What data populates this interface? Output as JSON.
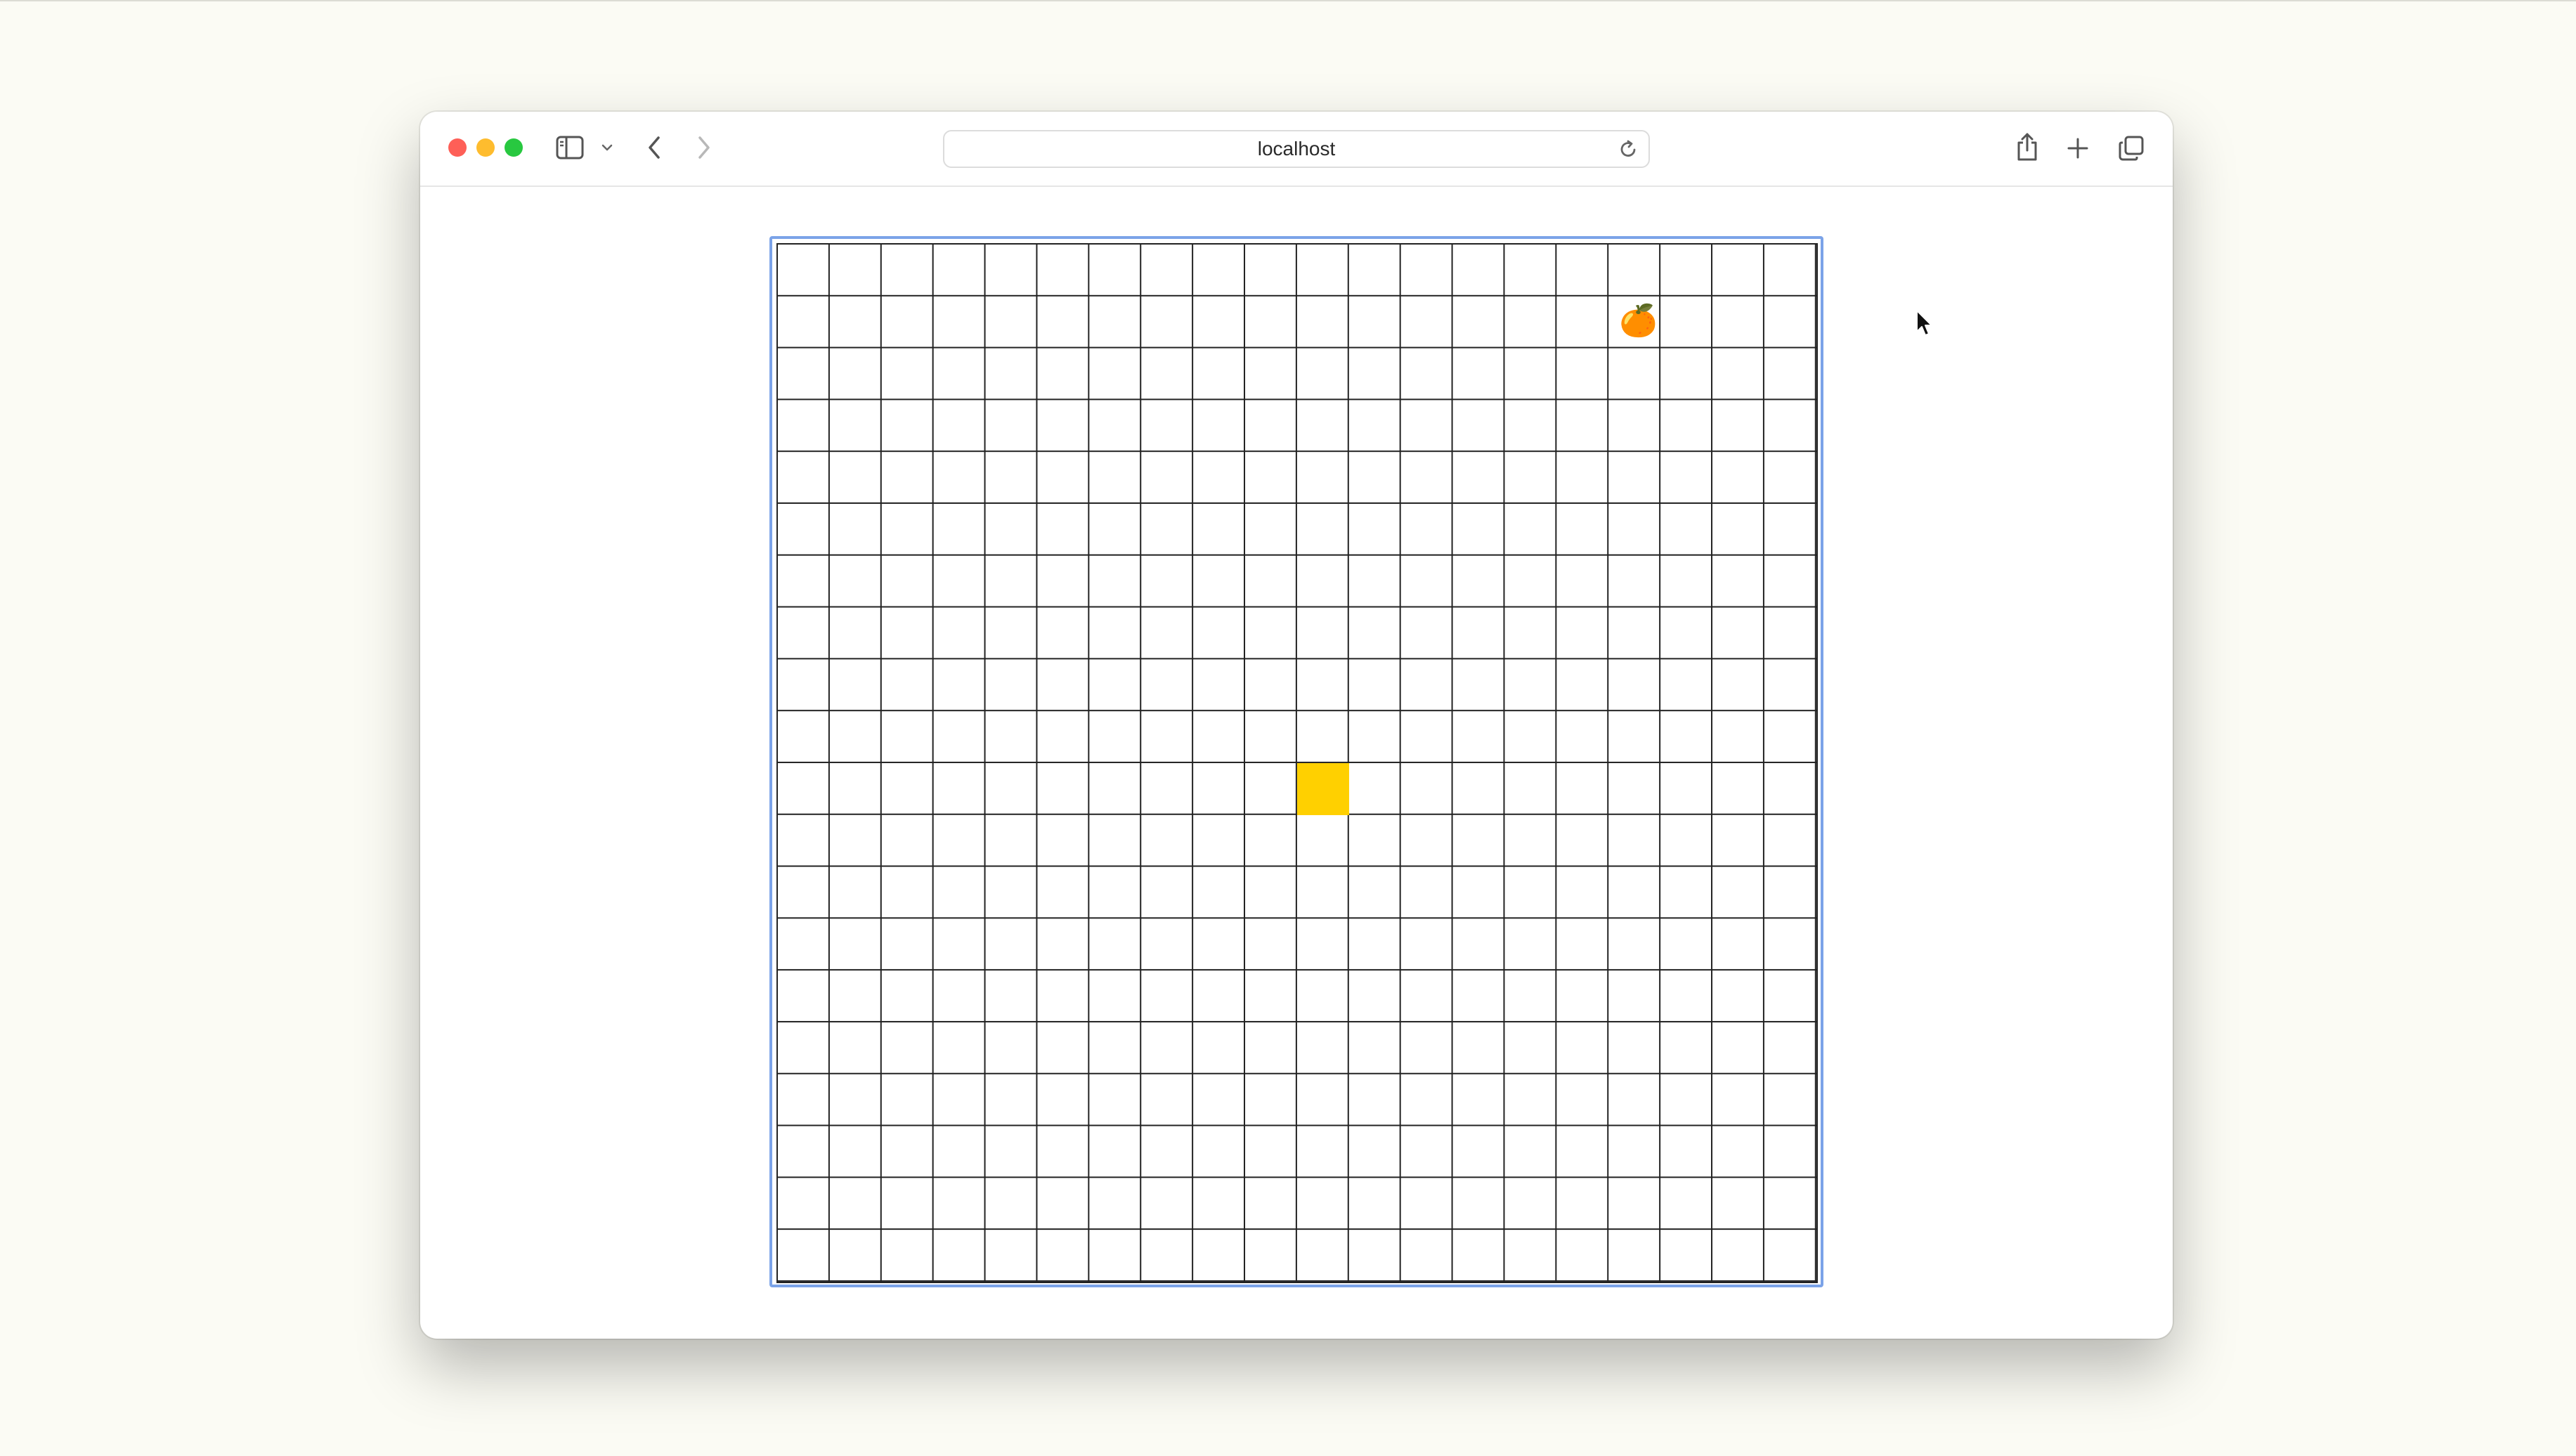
{
  "browser": {
    "address": "localhost"
  },
  "game": {
    "grid": {
      "columns": 20,
      "rows": 20
    },
    "snake": [
      {
        "col": 10,
        "row": 10
      }
    ],
    "food": {
      "col": 16,
      "row": 1,
      "icon": "apple-icon",
      "glyph": "🍊"
    },
    "colors": {
      "snake": "#ffd000",
      "grid_line": "#222222",
      "board_focus_outline": "#7ba3e8"
    }
  }
}
